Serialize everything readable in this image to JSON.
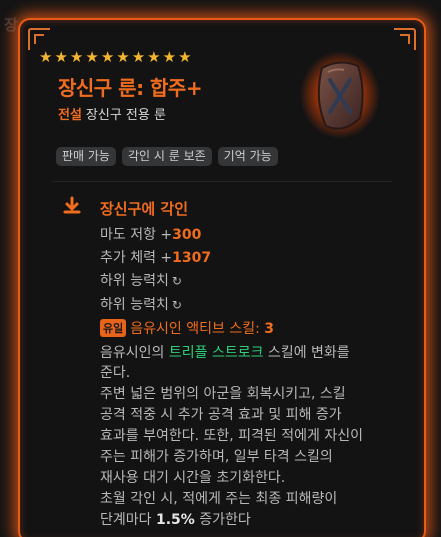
{
  "background_text": "장",
  "item": {
    "stars": 10,
    "name": "장신구 룬: 합주+",
    "grade": "전설",
    "type": "장신구 전용 룬",
    "tags": [
      "판매 가능",
      "각인 시 룬 보존",
      "기억 가능"
    ]
  },
  "engraving": {
    "title": "장신구에 각인",
    "stats": [
      {
        "label": "마도 저항 +",
        "value": "300"
      },
      {
        "label": "추가 체력 +",
        "value": "1307"
      }
    ],
    "sub_stats": [
      "하위 능력치",
      "하위 능력치"
    ],
    "unique_badge": "유일",
    "unique_label": "음유시인 액티브 스킬: ",
    "unique_value": "3",
    "desc": {
      "l1_pre": "음유시인의 ",
      "l1_skill": "트리플 스트로크",
      "l1_post": " 스킬에 변화를",
      "l2": "준다.",
      "l3": "주변 넓은 범위의 아군을 회복시키고, 스킬",
      "l4": "공격 적중 시 추가 공격 효과 및 피해 증가",
      "l5": "효과를 부여한다. 또한, 피격된 적에게 자신이",
      "l6": "주는 피해가 증가하며, 일부 타격 스킬의",
      "l7": "재사용 대기 시간을 초기화한다.",
      "l8": "초월 각인 시, 적에게 주는 최종 피해량이",
      "l9_pre": "단계마다 ",
      "l9_value": "1.5%",
      "l9_post": " 증가한다"
    }
  },
  "colors": {
    "accent": "#f06c1e",
    "skill": "#2fcf7a",
    "star": "#f4b531"
  },
  "icons": {
    "refresh": "refresh-icon",
    "engrave": "download-arrow-icon",
    "rune": "rune-stone-icon"
  }
}
